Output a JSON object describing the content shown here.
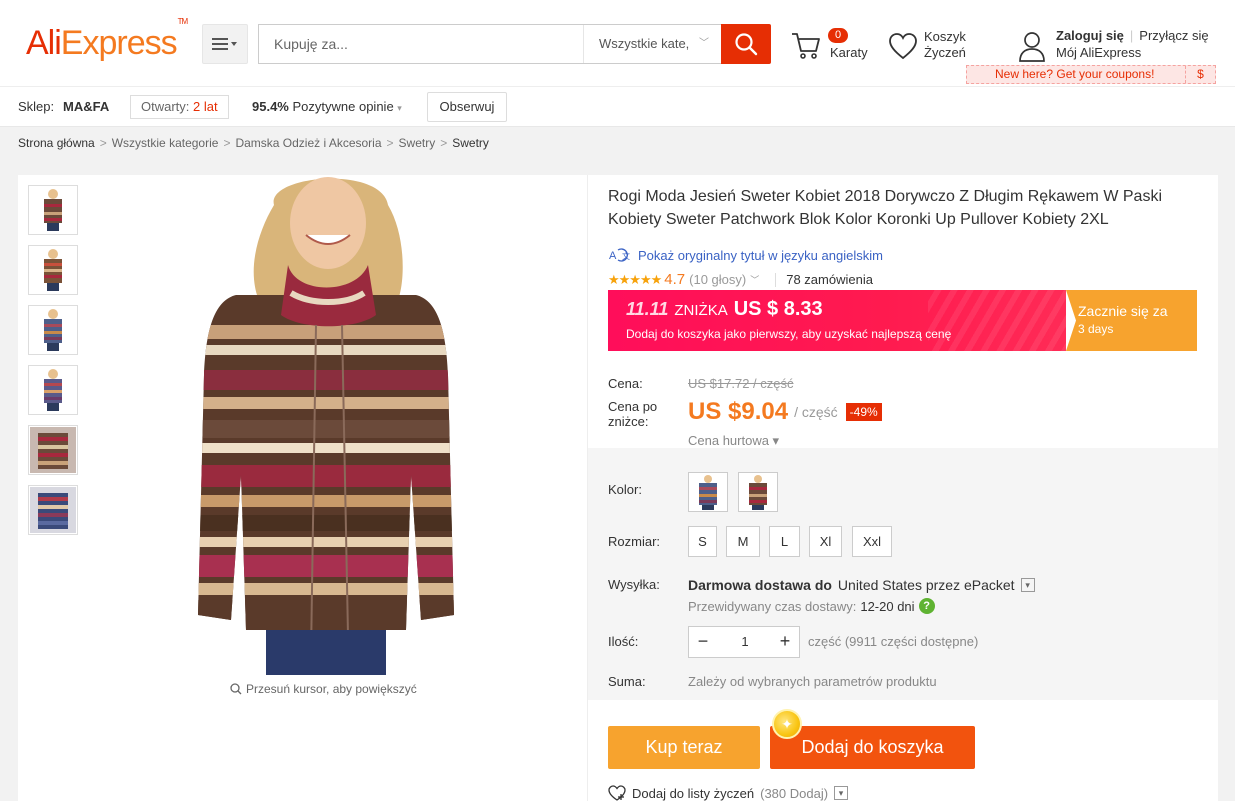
{
  "header": {
    "logo_part1": "Ali",
    "logo_part2": "Express",
    "logo_tm": "TM",
    "search_placeholder": "Kupuję za...",
    "search_category": "Wszystkie kate,",
    "cart_count": "0",
    "cart_label": "Karaty",
    "wishlist_label_1": "Koszyk",
    "wishlist_label_2": "Życzeń",
    "login": "Zaloguj się",
    "join": "Przyłącz się",
    "my_account": "Mój AliExpress",
    "coupon_text": "New here? Get your coupons!",
    "coupon_symbol": "$",
    "accent_color": "#e62e04"
  },
  "store": {
    "label": "Sklep:",
    "name": "MA&FA",
    "open_label": "Otwarty:",
    "open_value": "2 lat",
    "feedback_pct": "95.4%",
    "feedback_label": "Pozytywne opinie",
    "follow": "Obserwuj"
  },
  "breadcrumb": [
    "Strona główna",
    "Wszystkie kategorie",
    "Damska Odzież i Akcesoria",
    "Swetry",
    "Swetry"
  ],
  "gallery": {
    "zoom_hint": "Przesuń kursor, aby powiększyć"
  },
  "product": {
    "title": "Rogi Moda Jesień Sweter Kobiet 2018 Dorywczo Z Długim Rękawem W Paski Kobiety Sweter Patchwork Blok Kolor Koronki Up Pullover Kobiety 2XL",
    "original_title_link": "Pokaż oryginalny tytuł w języku angielskim",
    "stars": "★★★★★",
    "rating": "4.7",
    "votes": "(10 głosy)",
    "orders": "78 zamówienia"
  },
  "promo": {
    "event": "11.11",
    "label": "ZNIŻKA",
    "amount": "US $ 8.33",
    "subtitle": "Dodaj do koszyka jako pierwszy, aby uzyskać najlepszą cenę",
    "starts": "Zacznie się za",
    "days": "3 days"
  },
  "price": {
    "label": "Cena:",
    "old": "US $17.72 / część",
    "discount_label_1": "Cena po",
    "discount_label_2": "zniżce:",
    "new": "US $9.04",
    "unit": "/ część",
    "discount_pct": "-49%",
    "wholesale": "Cena hurtowa ▾"
  },
  "sku": {
    "color_label": "Kolor:",
    "size_label": "Rozmiar:",
    "sizes": [
      "S",
      "M",
      "L",
      "Xl",
      "Xxl"
    ],
    "shipping_label": "Wysyłka:",
    "shipping_free": "Darmowa dostawa do",
    "shipping_country": "United States przez ePacket",
    "delivery_label": "Przewidywany czas dostawy:",
    "delivery_days": "12-20 dni",
    "qty_label": "Ilość:",
    "qty_value": "1",
    "qty_available": "część (9911 części dostępne)",
    "total_label": "Suma:",
    "total_value": "Zależy od wybranych parametrów produktu"
  },
  "actions": {
    "buy_now": "Kup teraz",
    "add_to_cart": "Dodaj do koszyka",
    "wishlist": "Dodaj do listy życzeń",
    "wishlist_count": "(380 Dodaj)"
  }
}
